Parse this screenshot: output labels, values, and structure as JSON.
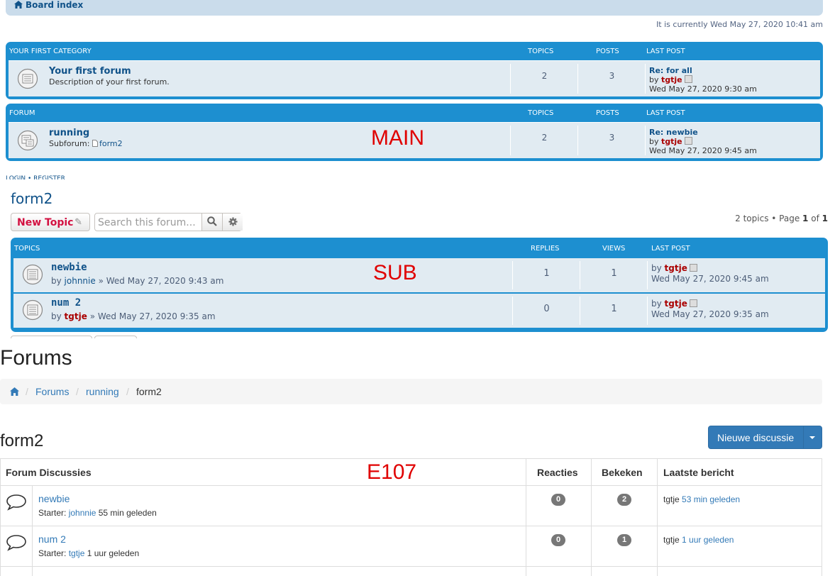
{
  "main": {
    "breadcrumb": "Board index",
    "current_time": "It is currently Wed May 27, 2020 10:41 am",
    "label": "MAIN",
    "categories": [
      {
        "name": "YOUR FIRST CATEGORY",
        "col_topics": "TOPICS",
        "col_posts": "POSTS",
        "col_last_post": "LAST POST",
        "forum": {
          "title": "Your first forum",
          "description": "Description of your first forum.",
          "topics": "2",
          "posts": "3",
          "last_post_title": "Re: for all",
          "last_post_by": "by",
          "last_post_user": "tgtje",
          "last_post_time": "Wed May 27, 2020 9:30 am"
        }
      },
      {
        "name": "FORUM",
        "col_topics": "TOPICS",
        "col_posts": "POSTS",
        "col_last_post": "LAST POST",
        "forum": {
          "title": "running",
          "subforum_label": "Subforum:",
          "subforum": "form2",
          "topics": "2",
          "posts": "3",
          "last_post_title": "Re: newbie",
          "last_post_by": "by",
          "last_post_user": "tgtje",
          "last_post_time": "Wed May 27, 2020 9:45 am"
        }
      }
    ],
    "cutoff_text": "LOGIN • REGISTER"
  },
  "sub": {
    "title": "form2",
    "label": "SUB",
    "new_topic_label": "New Topic",
    "search_placeholder": "Search this forum...",
    "pagination": {
      "prefix": "2 topics • Page",
      "page": "1",
      "of": "of",
      "total": "1"
    },
    "col_topics": "TOPICS",
    "col_replies": "REPLIES",
    "col_views": "VIEWS",
    "col_last_post": "LAST POST",
    "topics": [
      {
        "title": "newbie",
        "by": "by",
        "author": "johnnie",
        "date": "» Wed May 27, 2020 9:43 am",
        "replies": "1",
        "views": "1",
        "lp_by": "by",
        "lp_user": "tgtje",
        "lp_time": "Wed May 27, 2020 9:45 am"
      },
      {
        "title": "num 2",
        "by": "by",
        "author": "tgtje",
        "date": "» Wed May 27, 2020 9:35 am",
        "replies": "0",
        "views": "1",
        "lp_by": "by",
        "lp_user": "tgtje",
        "lp_time": "Wed May 27, 2020 9:35 am"
      }
    ]
  },
  "e107": {
    "heading": "Forums",
    "label": "E107",
    "breadcrumb": [
      "Forums",
      "running",
      "form2"
    ],
    "sep": "/",
    "forum_title": "form2",
    "new_discussion": "Nieuwe discussie",
    "columns": {
      "discussions": "Forum Discussies",
      "replies": "Reacties",
      "views": "Bekeken",
      "last": "Laatste bericht"
    },
    "rows": [
      {
        "title": "newbie",
        "starter_label": "Starter:",
        "starter": "johnnie",
        "age": "55 min geleden",
        "replies": "0",
        "views": "2",
        "last_user": "tgtje",
        "last_time": "53 min geleden"
      },
      {
        "title": "num 2",
        "starter_label": "Starter:",
        "starter": "tgtje",
        "age": "1 uur geleden",
        "replies": "0",
        "views": "1",
        "last_user": "tgtje",
        "last_time": "1 uur geleden"
      }
    ]
  },
  "colors": {
    "phpbb_blue": "#1d8fd0",
    "phpbb_row": "#e1ebf2",
    "link": "#105289",
    "user_red": "#aa0000",
    "label_red": "#e00000",
    "bootstrap_primary": "#337ab7"
  }
}
